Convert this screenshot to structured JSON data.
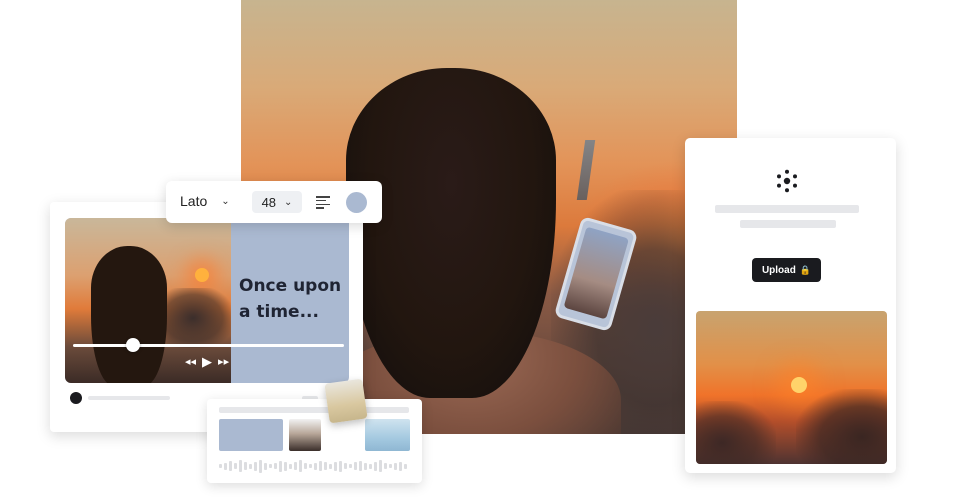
{
  "hero": {
    "image": "woman-photographing-sunset"
  },
  "toolbar": {
    "font_name": "Lato",
    "font_size": "48",
    "align_icon": "align-left-icon",
    "color": "#aab9d1"
  },
  "video": {
    "caption": "Once upon a time...",
    "progress": 0.22,
    "controls": {
      "rewind": "◂◂",
      "play": "▶",
      "forward": "▸▸"
    }
  },
  "upload": {
    "button_label": "Upload",
    "lock_icon": "🔒"
  },
  "colors": {
    "accent": "#aab9d1",
    "dark": "#1a1b1f",
    "placeholder": "#e6e7ea"
  }
}
